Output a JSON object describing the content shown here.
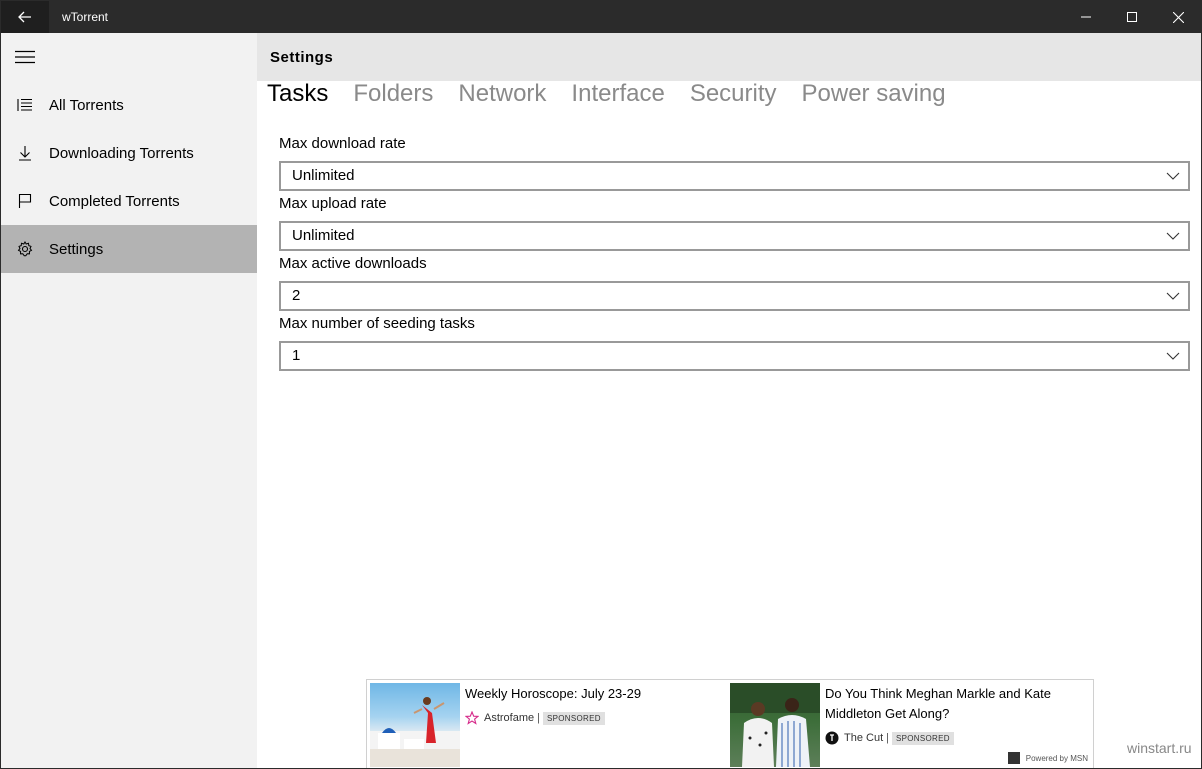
{
  "window": {
    "title": "wTorrent",
    "accent_bar_color": "#2b2b2b"
  },
  "sidebar": {
    "items": [
      {
        "label": "All Torrents",
        "icon": "list-icon"
      },
      {
        "label": "Downloading Torrents",
        "icon": "download-arrow-icon"
      },
      {
        "label": "Completed Torrents",
        "icon": "flag-icon"
      },
      {
        "label": "Settings",
        "icon": "gear-icon",
        "active": true
      }
    ]
  },
  "header": {
    "title": "Settings"
  },
  "tabs": [
    {
      "label": "Tasks",
      "active": true
    },
    {
      "label": "Folders"
    },
    {
      "label": "Network"
    },
    {
      "label": "Interface"
    },
    {
      "label": "Security"
    },
    {
      "label": "Power saving"
    }
  ],
  "settings": {
    "max_download_rate": {
      "label": "Max download rate",
      "value": "Unlimited"
    },
    "max_upload_rate": {
      "label": "Max upload rate",
      "value": "Unlimited"
    },
    "max_active_downloads": {
      "label": "Max active downloads",
      "value": "2"
    },
    "max_seeding_tasks": {
      "label": "Max number of seeding tasks",
      "value": "1"
    }
  },
  "ads": [
    {
      "title": "Weekly Horoscope: July 23-29",
      "source": "Astrofame",
      "sponsored": "SPONSORED"
    },
    {
      "title": "Do You Think Meghan Markle and Kate Middleton Get Along?",
      "source": "The Cut",
      "sponsored": "SPONSORED"
    }
  ],
  "ad_footer": {
    "powered_by": "Powered by MSN"
  },
  "watermark": "winstart.ru"
}
